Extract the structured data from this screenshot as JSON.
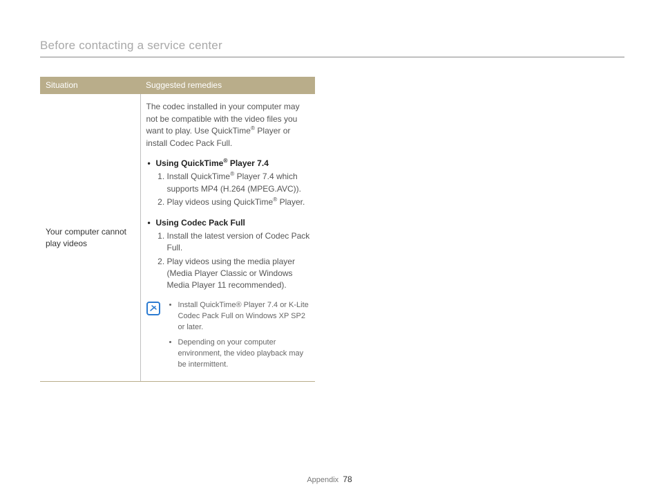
{
  "section_title": "Before contacting a service center",
  "table": {
    "headers": {
      "situation": "Situation",
      "remedies": "Suggested remedies"
    },
    "row": {
      "situation": "Your computer cannot play videos",
      "intro_html": "The codec installed in your computer may not be compatible with the video files you want to play. Use QuickTime<sup>®</sup> Player or install Codec Pack Full.",
      "qt_head_html": "Using QuickTime<sup>®</sup> Player 7.4",
      "qt_steps_html": [
        "Install QuickTime<sup>®</sup> Player 7.4 which supports MP4 (H.264 (MPEG.AVC)).",
        "Play videos using QuickTime<sup>®</sup> Player."
      ],
      "cp_head": "Using Codec Pack Full",
      "cp_steps": [
        "Install the latest version of Codec Pack Full.",
        "Play videos using the media player (Media Player Classic or Windows Media Player 11 recommended)."
      ],
      "notes": [
        "Install QuickTime® Player 7.4 or K-Lite Codec Pack Full on Windows XP SP2 or later.",
        "Depending on your computer environment, the video playback may be intermittent."
      ]
    }
  },
  "footer": {
    "section": "Appendix",
    "page": "78"
  }
}
